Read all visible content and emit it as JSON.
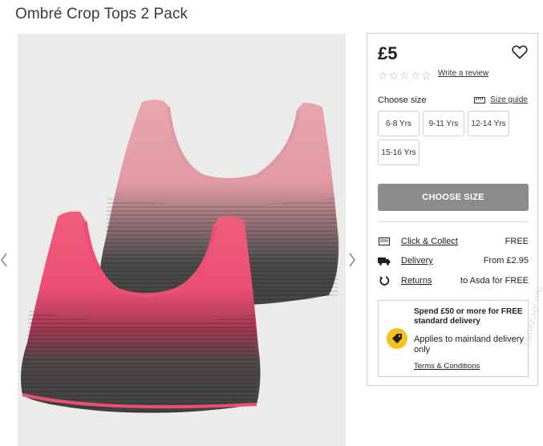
{
  "product": {
    "title": "Ombré Crop Tops 2 Pack"
  },
  "gallery": {
    "prev_icon": "chevron-left-icon",
    "next_icon": "chevron-right-icon",
    "colors": {
      "top_back_top": "#e8a6ae",
      "top_back_bottom": "#4a4a4a",
      "top_front_top": "#ef5d7c",
      "top_front_bottom": "#484848",
      "trim_front": "#ec4f74",
      "trim_back": "#dd9aa6"
    }
  },
  "purchase": {
    "price": "£5",
    "wishlist_icon": "heart-icon",
    "rating_stars": 0,
    "write_review": "Write a review",
    "choose_size_label": "Choose size",
    "size_guide": "Size guide",
    "sizes": [
      "6-8 Yrs",
      "9-11 Yrs",
      "12-14 Yrs",
      "15-16 Yrs"
    ],
    "choose_size_button": "CHOOSE SIZE"
  },
  "delivery": [
    {
      "icon": "store-icon",
      "label": "Click & Collect",
      "value": "FREE"
    },
    {
      "icon": "truck-icon",
      "label": "Delivery",
      "value": "From £2.95"
    },
    {
      "icon": "return-icon",
      "label": "Returns",
      "value": "to Asda for FREE"
    }
  ],
  "promo": {
    "headline": "Spend £50 or more for FREE standard delivery",
    "badge_icon": "tag-icon",
    "body": "Applies to mainland delivery only",
    "terms": "Terms & Conditions",
    "badge_color": "#f5c31b"
  },
  "watermark": "Indiez.sgi.org"
}
